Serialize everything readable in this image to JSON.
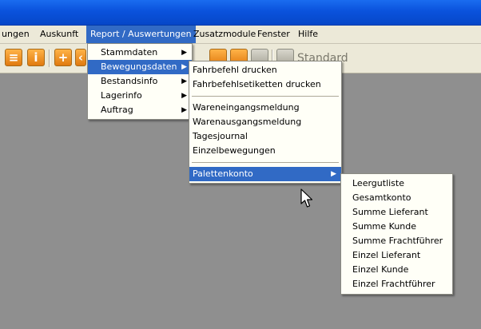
{
  "menubar": [
    {
      "label": "ungen",
      "name": "menu-ungen",
      "active": false
    },
    {
      "label": "Auskunft",
      "name": "menu-auskunft",
      "active": false
    },
    {
      "label": "Report / Auswertungen",
      "name": "menu-report-auswertungen",
      "active": true
    },
    {
      "label": "Zusatzmodule",
      "name": "menu-zusatzmodule",
      "active": false
    },
    {
      "label": "Fenster",
      "name": "menu-fenster",
      "active": false
    },
    {
      "label": "Hilfe",
      "name": "menu-hilfe",
      "active": false
    }
  ],
  "toolbar": {
    "info_glyph": "i",
    "add_glyph": "+",
    "label": "Standard"
  },
  "report_menu": [
    {
      "label": "Stammdaten",
      "submenu": true
    },
    {
      "label": "Bewegungsdaten",
      "submenu": true,
      "highlighted": true
    },
    {
      "label": "Bestandsinfo",
      "submenu": true
    },
    {
      "label": "Lagerinfo",
      "submenu": true
    },
    {
      "label": "Auftrag",
      "submenu": true
    }
  ],
  "bewegungsdaten_menu": {
    "group1": [
      "Fahrbefehl drucken",
      "Fahrbefehlsetiketten drucken"
    ],
    "group2": [
      "Wareneingangsmeldung",
      "Warenausgangsmeldung",
      "Tagesjournal",
      "Einzelbewegungen"
    ],
    "group3": [
      {
        "label": "Palettenkonto",
        "submenu": true,
        "highlighted": true
      }
    ]
  },
  "palettenkonto_menu": [
    "Leergutliste",
    "Gesamtkonto",
    "Summe Lieferant",
    "Summe Kunde",
    "Summe Frachtführer",
    "Einzel Lieferant",
    "Einzel Kunde",
    "Einzel Frachtführer"
  ],
  "colors": {
    "highlight": "#316ac5",
    "titlebar": "#0a52dc",
    "menu_bg": "#fffff7",
    "workspace": "#8f8f8f"
  }
}
